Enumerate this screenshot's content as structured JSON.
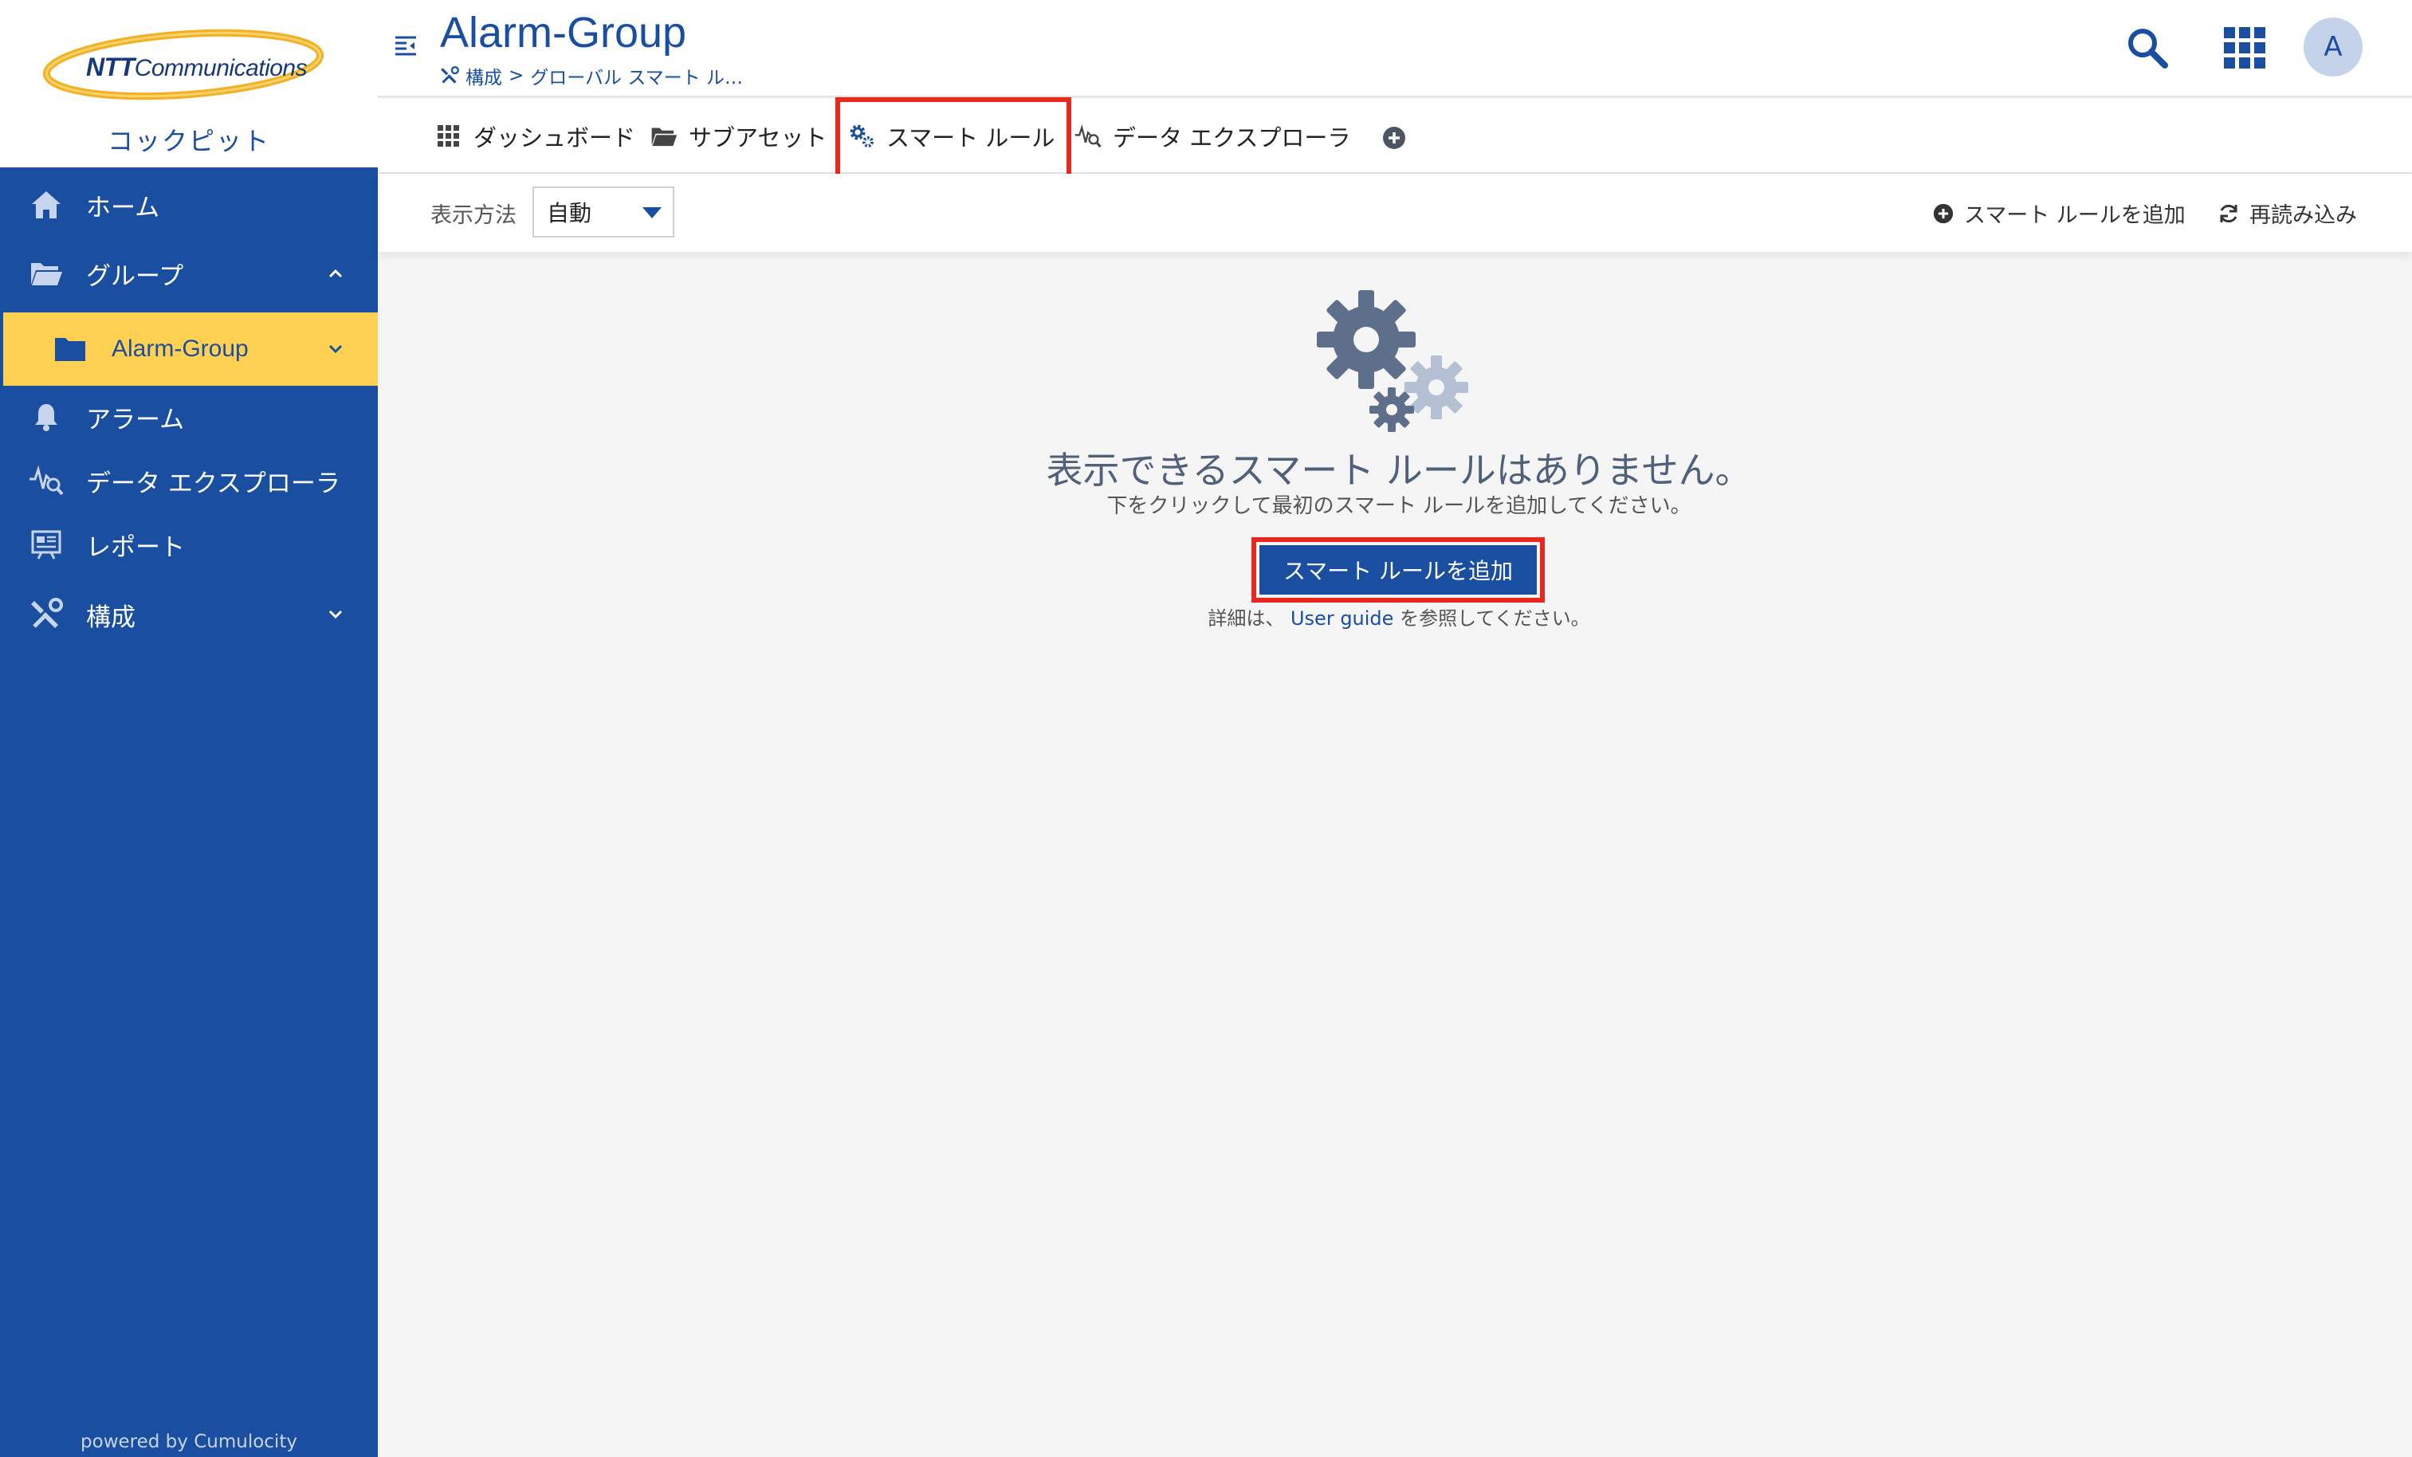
{
  "brand": {
    "logo_prefix": "NTT",
    "logo_name": "Communications",
    "app_name": "コックピット",
    "powered_by": "powered by Cumulocity"
  },
  "sidebar": {
    "items": [
      {
        "label": "ホーム",
        "icon": "home-icon"
      },
      {
        "label": "グループ",
        "icon": "folder-open-icon"
      },
      {
        "label": "Alarm-Group",
        "icon": "folder-icon",
        "active": true
      },
      {
        "label": "アラーム",
        "icon": "bell-icon"
      },
      {
        "label": "データ エクスプローラ",
        "icon": "data-explorer-icon"
      },
      {
        "label": "レポート",
        "icon": "report-icon"
      },
      {
        "label": "構成",
        "icon": "wrench-icon"
      }
    ]
  },
  "header": {
    "title": "Alarm-Group",
    "breadcrumb": {
      "part1": "構成",
      "separator": ">",
      "part2": "グローバル スマート ル…"
    },
    "avatar_initial": "A"
  },
  "tabs": [
    {
      "label": "ダッシュボード",
      "icon": "grid-icon"
    },
    {
      "label": "サブアセット",
      "icon": "folder-open-icon"
    },
    {
      "label": "スマート ルール",
      "icon": "cogs-icon",
      "highlighted": true
    },
    {
      "label": "データ エクスプローラ",
      "icon": "data-explorer-icon"
    }
  ],
  "actionbar": {
    "display_label": "表示方法",
    "display_value": "自動",
    "add_rule": "スマート ルールを追加",
    "reload": "再読み込み"
  },
  "empty_state": {
    "title": "表示できるスマート ルールはありません。",
    "subtitle": "下をクリックして最初のスマート ルールを追加してください。",
    "button": "スマート ルールを追加",
    "help_prefix": "詳細は、",
    "help_link": "User guide",
    "help_suffix": "を参照してください。"
  },
  "colors": {
    "primary": "#1a4ea0",
    "active_nav": "#fed152",
    "highlight": "#e8281e",
    "background": "#f5f5f5"
  }
}
